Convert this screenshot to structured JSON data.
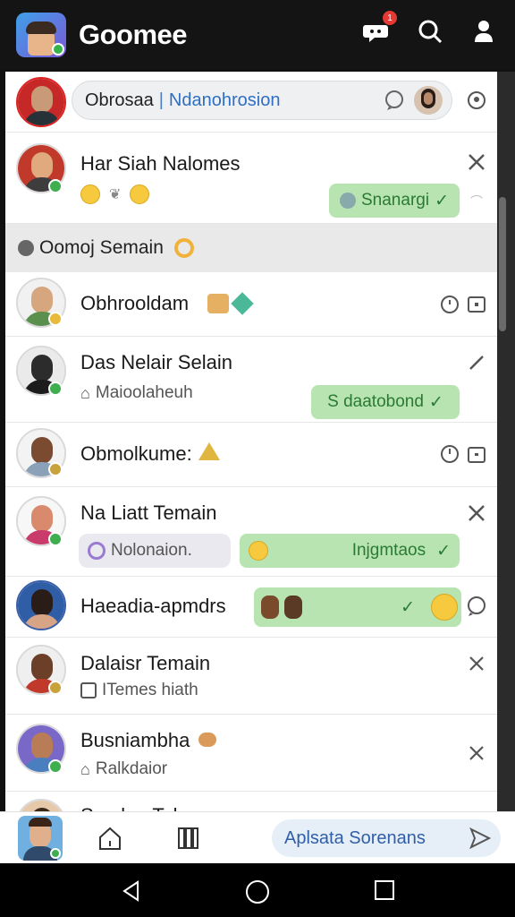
{
  "app": {
    "title": "Goomee",
    "notification_count": "1"
  },
  "search": {
    "left_text": "Obrosaa",
    "right_text": "Ndanohrosion"
  },
  "section": {
    "label": "Oomoj Semain"
  },
  "chats": [
    {
      "name": "Har Siah Nalomes",
      "pill": "Snanargi",
      "action": "close"
    },
    {
      "name": "Obhrooldam",
      "action": "clock"
    },
    {
      "name": "Das Nelair Selain",
      "sub": "Maioolaheuh",
      "pill": "S daatobond",
      "action": "edit"
    },
    {
      "name": "Obmolkume:",
      "action": "clock"
    },
    {
      "name": "Na Liatt Temain",
      "sub": "Nolonaion.",
      "pill": "Injgmtaos",
      "action": "close"
    },
    {
      "name": "Haeadia-apmdrs",
      "action": "chat"
    },
    {
      "name": "Dalaisr Temain",
      "sub": "ITemes hiath",
      "action": "close"
    },
    {
      "name": "Busniambha",
      "sub": "Ralkdaior",
      "action": "close"
    },
    {
      "name": "Sasdan Tolomara"
    }
  ],
  "bottom_bar": {
    "send_placeholder": "Aplsata Sorenans"
  },
  "colors": {
    "accent_green": "#b7e4b0",
    "link_blue": "#2f6fc1",
    "badge_red": "#e53935"
  }
}
